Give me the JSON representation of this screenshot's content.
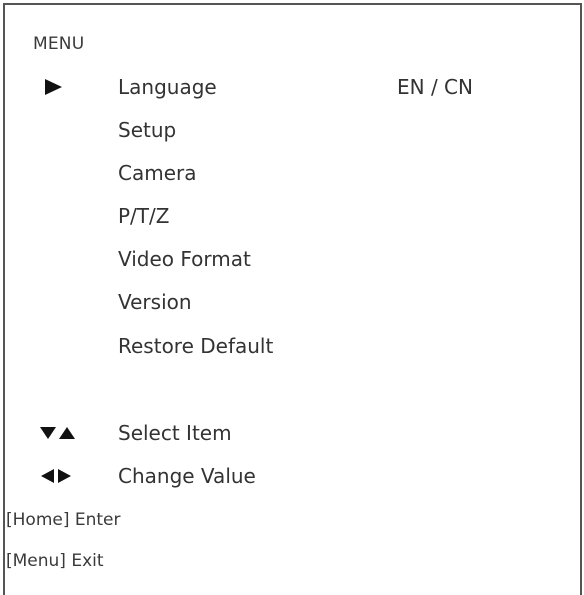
{
  "menu": {
    "title": "MENU",
    "selected_index": 0,
    "items": [
      {
        "label": "Language",
        "value": "EN / CN"
      },
      {
        "label": "Setup"
      },
      {
        "label": "Camera"
      },
      {
        "label": "P/T/Z"
      },
      {
        "label": "Video Format"
      },
      {
        "label": "Version"
      },
      {
        "label": "Restore Default"
      }
    ]
  },
  "help": {
    "select_label": "Select Item",
    "select_icon": "down-up-arrows-icon",
    "change_label": "Change Value",
    "change_icon": "left-right-arrows-icon",
    "enter_key": "[Home]",
    "enter_label": "Enter",
    "exit_key": "[Menu]",
    "exit_label": "Exit"
  },
  "colors": {
    "text": "#333333",
    "arrow": "#111111",
    "border": "#555555",
    "background": "#ffffff"
  }
}
